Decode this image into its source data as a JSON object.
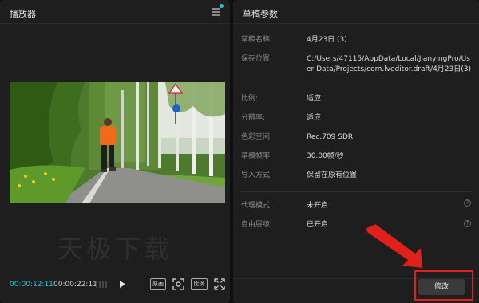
{
  "player": {
    "title": "播放器",
    "watermark": "天极下载",
    "time_current": "00:00:12:11",
    "time_total": "00:00:22:11",
    "buttons": {
      "original_label": "原画",
      "ratio_label": "比例"
    }
  },
  "draft": {
    "title": "草稿参数",
    "params": [
      {
        "label": "草稿名称:",
        "value": "4月23日 (3)"
      },
      {
        "label": "保存位置:",
        "value": "C:/Users/47115/AppData/Local/JianyingPro/User Data/Projects/com.lveditor.draft/4月23日(3)"
      },
      {
        "label": "比例:",
        "value": "适应"
      },
      {
        "label": "分辨率:",
        "value": "适应"
      },
      {
        "label": "色彩空间:",
        "value": "Rec.709 SDR"
      },
      {
        "label": "草稿帧率:",
        "value": "30.00帧/秒"
      },
      {
        "label": "导入方式:",
        "value": "保留在原有位置"
      }
    ],
    "extra_params": [
      {
        "label": "代理模式",
        "value": "未开启"
      },
      {
        "label": "自由层级:",
        "value": "已开启"
      }
    ],
    "modify_label": "修改"
  },
  "colors": {
    "accent": "#1fc7d6",
    "annotation": "#e0201a"
  }
}
